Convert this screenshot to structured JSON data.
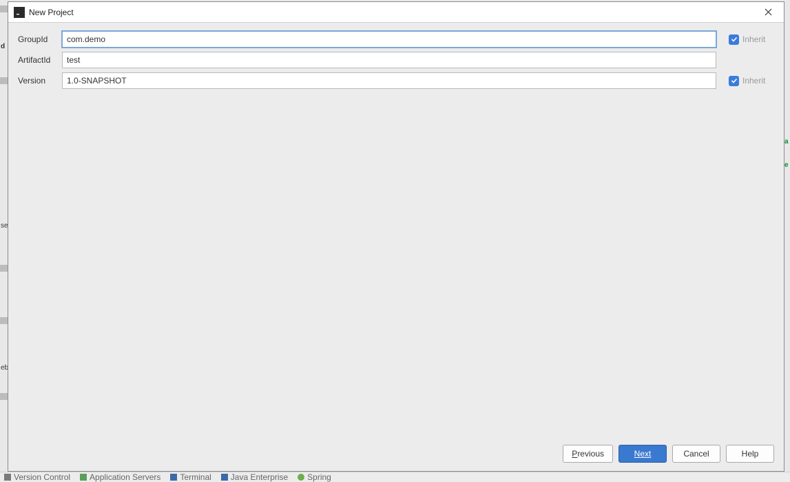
{
  "title": "New Project",
  "fields": {
    "groupId": {
      "label": "GroupId",
      "value": "com.demo",
      "inherit": true
    },
    "artifactId": {
      "label": "ArtifactId",
      "value": "test"
    },
    "version": {
      "label": "Version",
      "value": "1.0-SNAPSHOT",
      "inherit": true
    }
  },
  "inheritLabel": "Inherit",
  "buttons": {
    "previous": "Previous",
    "next": "Next",
    "cancel": "Cancel",
    "help": "Help"
  },
  "bottomTabs": [
    "Version Control",
    "Application Servers",
    "Terminal",
    "Java Enterprise",
    "Spring"
  ],
  "leftMarks": {
    "d": "d",
    "se": "se",
    "eb": "eb"
  }
}
